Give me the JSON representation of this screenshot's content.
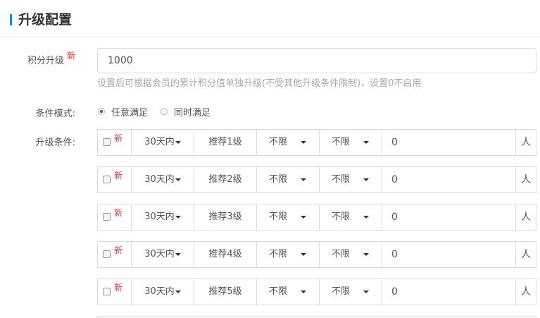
{
  "header": {
    "title": "升级配置",
    "accent_color": "#1e88e5"
  },
  "points_upgrade": {
    "label": "积分升级",
    "new_badge": "新",
    "value": "1000",
    "hint": "设置后可根据会员的累计积分值单独升级(不受其他升级条件限制)，设置0不启用"
  },
  "condition_mode": {
    "label": "条件模式:",
    "options": [
      {
        "label": "任意满足",
        "selected": true
      },
      {
        "label": "同时满足",
        "selected": false
      }
    ]
  },
  "conditions": {
    "label": "升级条件:",
    "rows": [
      {
        "checked": false,
        "new_badge": "新",
        "days": "30天内",
        "level": "推荐1级",
        "limit_a": "不限",
        "limit_b": "不限",
        "count": "0",
        "unit": "人"
      },
      {
        "checked": false,
        "new_badge": "新",
        "days": "30天内",
        "level": "推荐2级",
        "limit_a": "不限",
        "limit_b": "不限",
        "count": "0",
        "unit": "人"
      },
      {
        "checked": false,
        "new_badge": "新",
        "days": "30天内",
        "level": "推荐3级",
        "limit_a": "不限",
        "limit_b": "不限",
        "count": "0",
        "unit": "人"
      },
      {
        "checked": false,
        "new_badge": "新",
        "days": "30天内",
        "level": "推荐4级",
        "limit_a": "不限",
        "limit_b": "不限",
        "count": "0",
        "unit": "人"
      },
      {
        "checked": false,
        "new_badge": "新",
        "days": "30天内",
        "level": "推荐5级",
        "limit_a": "不限",
        "limit_b": "不限",
        "count": "0",
        "unit": "人"
      }
    ]
  }
}
